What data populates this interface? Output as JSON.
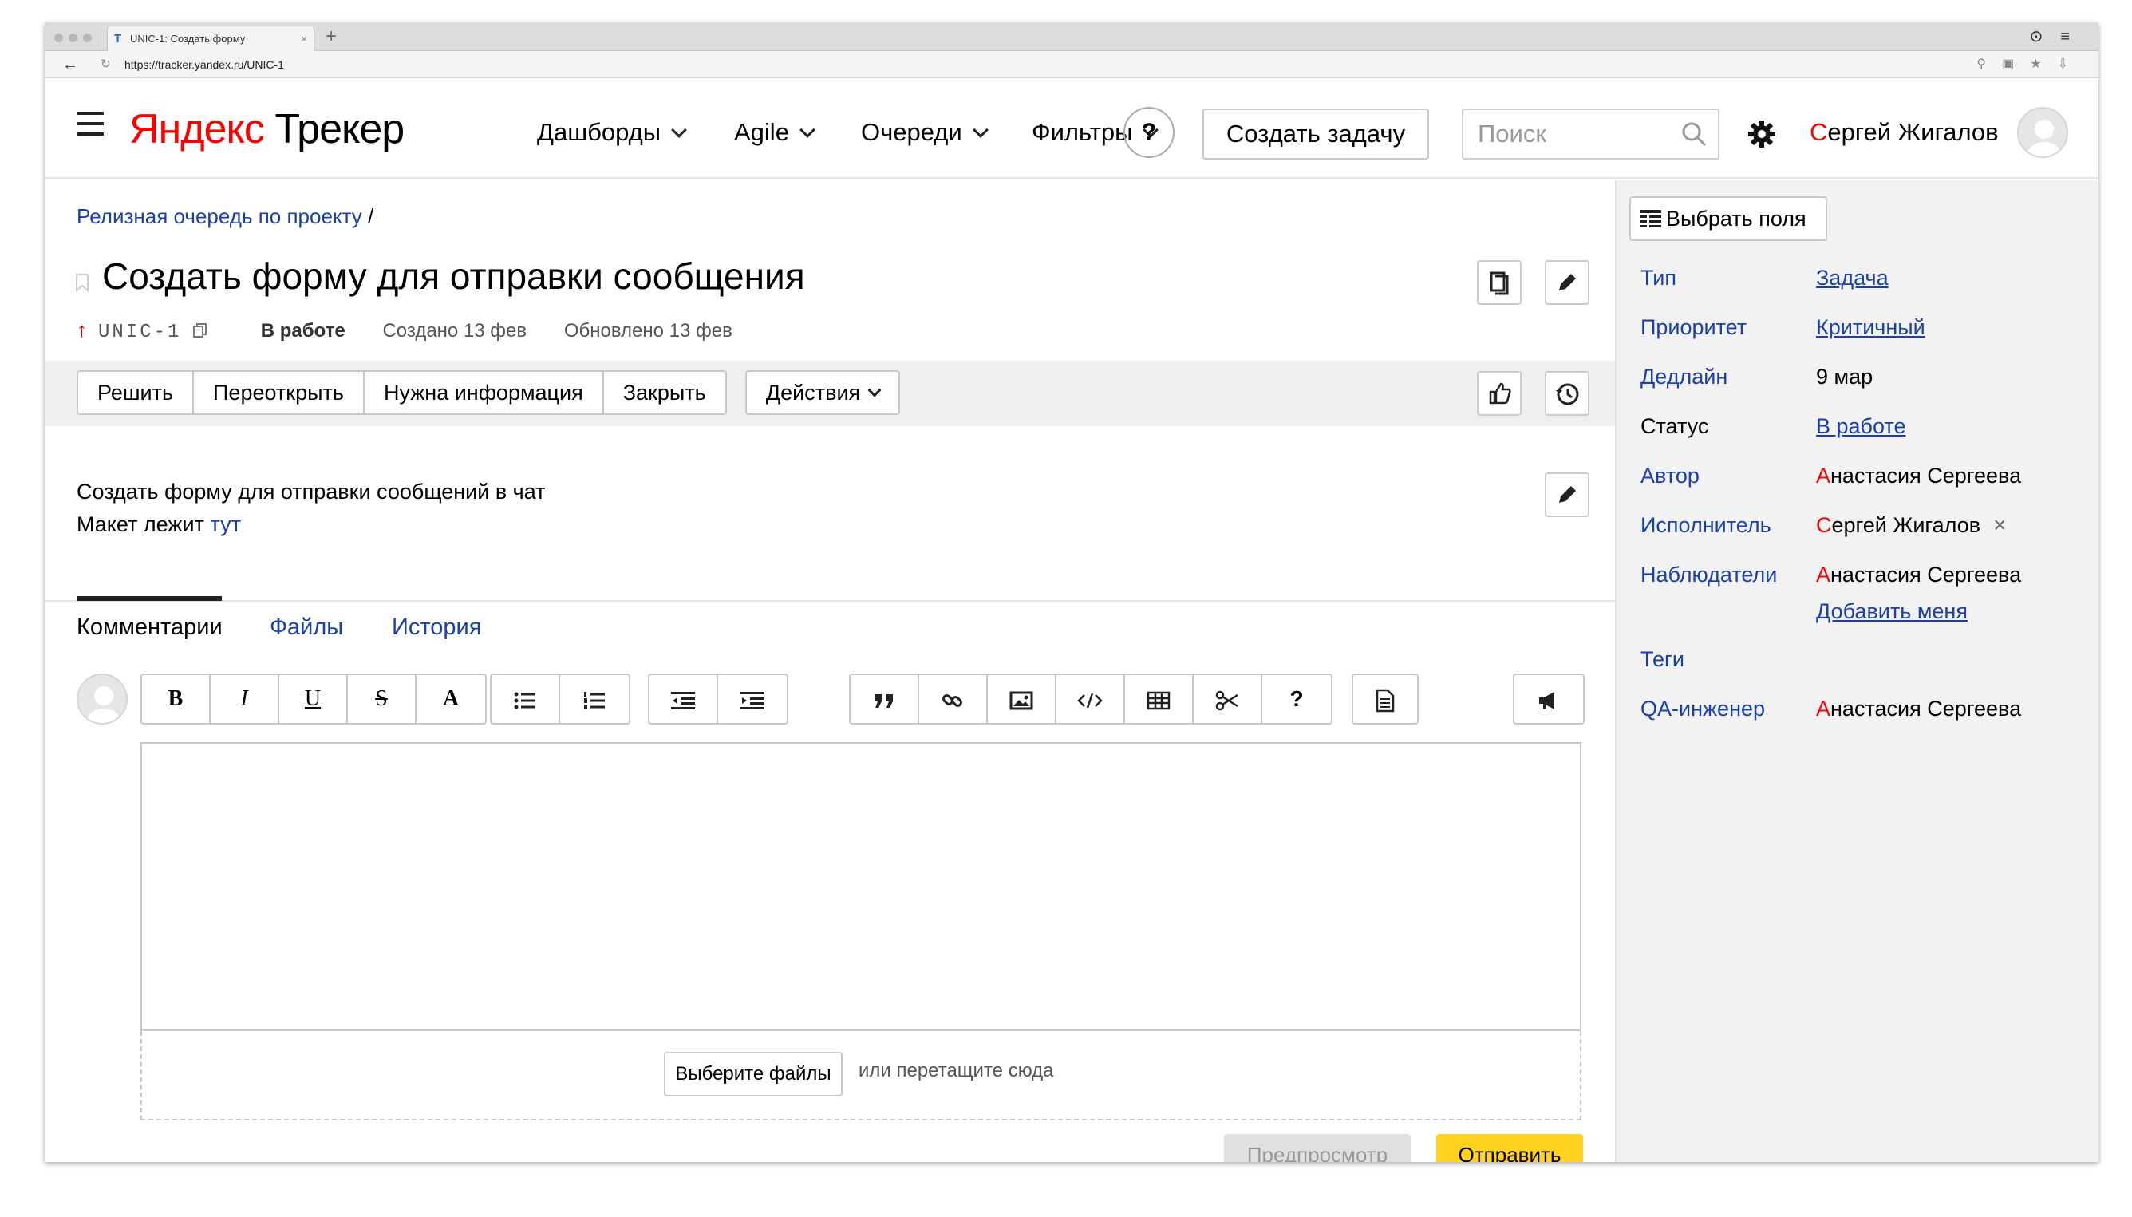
{
  "browser": {
    "tab_title": "UNIC-1: Создать форму",
    "tab_close": "×",
    "new_tab": "+",
    "url": "https://tracker.yandex.ru/UNIC-1"
  },
  "header": {
    "logo_brand": "Яндекс",
    "logo_product": "Трекер",
    "nav": [
      {
        "label": "Дашборды"
      },
      {
        "label": "Agile"
      },
      {
        "label": "Очереди"
      },
      {
        "label": "Фильтры"
      }
    ],
    "help_label": "?",
    "create_task_label": "Создать задачу",
    "search_placeholder": "Поиск",
    "user_first_letter": "С",
    "user_name_rest": "ергей Жигалов"
  },
  "issue": {
    "breadcrumb_queue": "Релизная очередь по проекту",
    "breadcrumb_sep": "/",
    "title": "Создать форму для отправки сообщения",
    "key": "UNIC-1",
    "status": "В работе",
    "created": "Создано 13 фев",
    "updated": "Обновлено 13 фев",
    "priority_arrow": "↑",
    "workflow_buttons": [
      "Решить",
      "Переоткрыть",
      "Нужна информация",
      "Закрыть"
    ],
    "actions_label": "Действия",
    "description_line1": "Создать форму для отправки сообщений в чат",
    "description_line2_prefix": "Макет лежит",
    "description_link": "тут"
  },
  "tabs": {
    "comments": "Комментарии",
    "files": "Файлы",
    "history": "История"
  },
  "toolbar": {
    "bold": "B",
    "italic": "I",
    "underline": "U",
    "strike": "S",
    "font": "A",
    "help": "?"
  },
  "comment_form": {
    "choose_files": "Выберите файлы",
    "drop_hint": "или перетащите сюда",
    "preview": "Предпросмотр",
    "send": "Отправить"
  },
  "sidebar": {
    "select_fields": "Выбрать поля",
    "fields": {
      "type_label": "Тип",
      "type_value": "Задача",
      "priority_label": "Приоритет",
      "priority_value": "Критичный",
      "deadline_label": "Дедлайн",
      "deadline_value": "9 мар",
      "status_label": "Статус",
      "status_value": "В работе",
      "author_label": "Автор",
      "author_first": "А",
      "author_rest": "настасия Сергеева",
      "assignee_label": "Исполнитель",
      "assignee_first": "С",
      "assignee_rest": "ергей Жигалов",
      "assignee_remove": "×",
      "followers_label": "Наблюдатели",
      "follower_first": "А",
      "follower_rest": "настасия Сергеева",
      "add_me": "Добавить меня",
      "tags_label": "Теги",
      "qa_label": "QA-инженер",
      "qa_first": "А",
      "qa_rest": "настасия Сергеева"
    }
  },
  "colors": {
    "link": "#1a3fae",
    "brand_red": "#ff0000",
    "send_button": "#ffd21f",
    "sidebar_bg": "#f2f2f2"
  },
  "icons": [
    "menu-icon",
    "chevron-down-icon",
    "search-icon",
    "gear-icon",
    "copy-icon",
    "pencil-icon",
    "thumbs-up-icon",
    "history-icon",
    "bullet-list-icon",
    "numbered-list-icon",
    "outdent-icon",
    "indent-icon",
    "quote-icon",
    "link-icon",
    "image-icon",
    "code-icon",
    "table-icon",
    "cut-icon",
    "page-icon",
    "megaphone-icon",
    "fields-icon"
  ]
}
